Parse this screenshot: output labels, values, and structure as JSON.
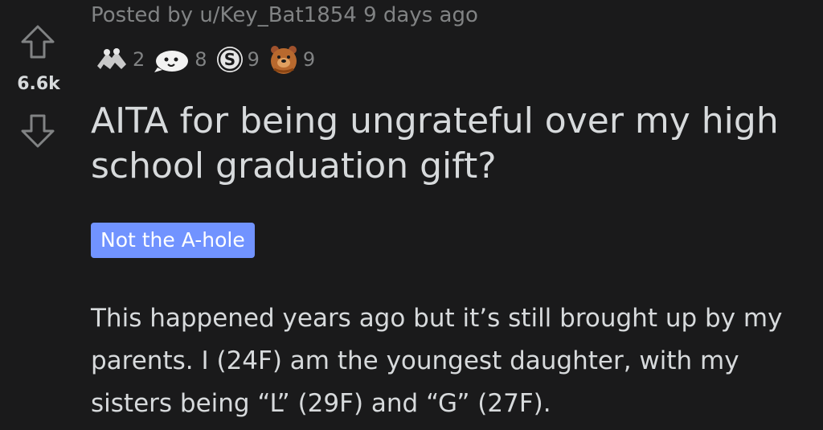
{
  "vote": {
    "score": "6.6k"
  },
  "post": {
    "meta": "Posted by u/Key_Bat1854 9 days ago",
    "awards": [
      {
        "icon": "hands-award-icon",
        "count": "2"
      },
      {
        "icon": "wholesome-seal-award-icon",
        "count": "8"
      },
      {
        "icon": "silver-s-award-icon",
        "count": "9"
      },
      {
        "icon": "bear-award-icon",
        "count": "9"
      }
    ],
    "title": "AITA for being ungrateful over my high school graduation gift?",
    "flair": "Not the A-hole",
    "body": "This happened years ago but it’s still brought up by my parents. I (24F) am the youngest daughter, with my sisters being “L” (29F) and “G” (27F)."
  },
  "colors": {
    "background": "#1a1a1b",
    "text": "#d7dadc",
    "muted": "#818384",
    "flair": "#7193ff"
  }
}
